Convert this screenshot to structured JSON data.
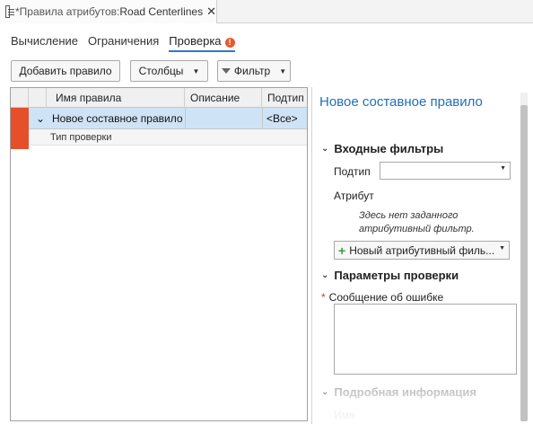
{
  "doc_tab": {
    "title": "*Правила атрибутов:",
    "layer": "Road Centerlines",
    "close": "✕"
  },
  "subtabs": [
    {
      "label": "Вычисление"
    },
    {
      "label": "Ограничения"
    },
    {
      "label": "Проверка",
      "active": true
    }
  ],
  "warning_badge": "!",
  "toolbar": {
    "add_rule": "Добавить правило",
    "columns": "Столбцы",
    "filter": "Фильтр",
    "caret": "▼"
  },
  "grid": {
    "columns": [
      "Имя правила",
      "Описание",
      "Подтип"
    ],
    "rows": [
      {
        "expander": "⌄",
        "name": "Новое составное правило",
        "description": "",
        "subtype": "<Все>"
      }
    ],
    "subrow_label": "Тип проверки"
  },
  "panel": {
    "title": "Новое составное правило",
    "input_filters": "Входные фильтры",
    "subtype_label": "Подтип",
    "subtype_value": "",
    "attribute_label": "Атрибут",
    "note_line1": "Здесь нет заданного",
    "note_line2": "атрибутивный фильтр.",
    "new_filter_button": "Новый атрибутивный филь...",
    "check_params": "Параметры проверки",
    "error_message_label": "Сообщение об ошибке",
    "required_marker": "*",
    "details": "Подробная информация",
    "name_label": "Имя"
  },
  "colors": {
    "accent": "#2b7ac9",
    "error": "#e5502a",
    "title_blue": "#1f6fb8",
    "selected_row": "#cfe3f6"
  }
}
